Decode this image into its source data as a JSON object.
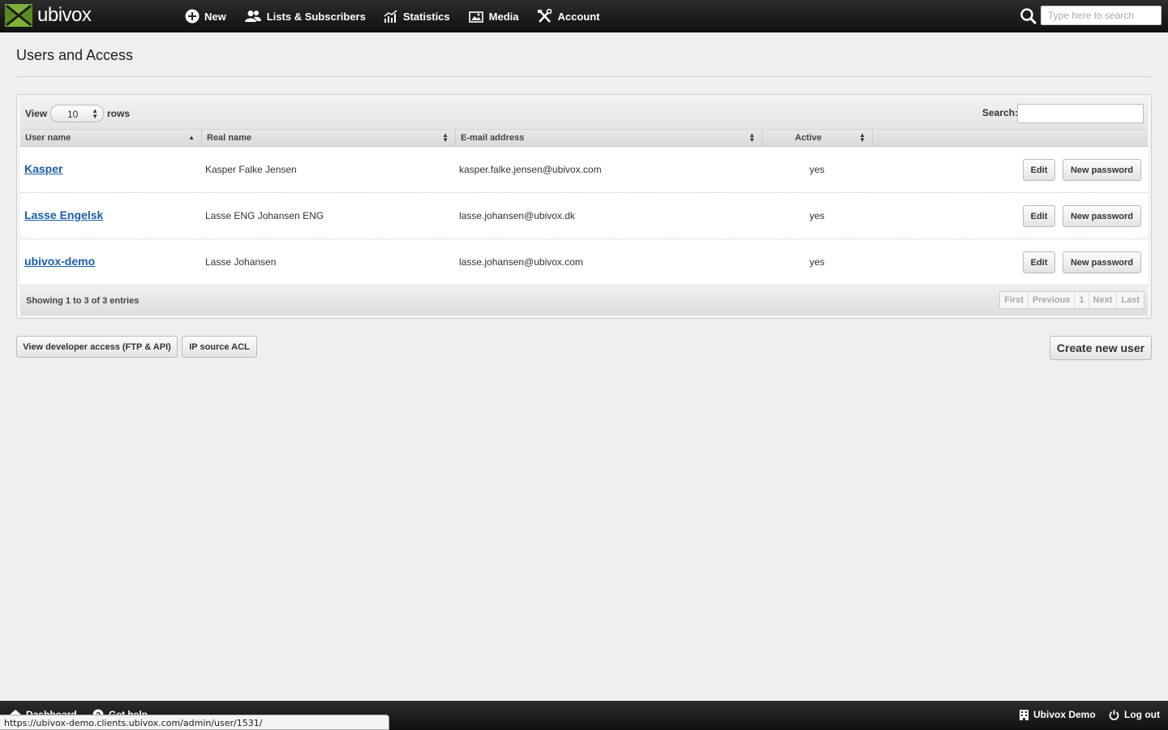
{
  "header": {
    "logo_text": "ubivox",
    "nav": [
      {
        "label": "New",
        "icon": "plus-circle-icon"
      },
      {
        "label": "Lists & Subscribers",
        "icon": "users-icon"
      },
      {
        "label": "Statistics",
        "icon": "bar-chart-icon"
      },
      {
        "label": "Media",
        "icon": "image-icon"
      },
      {
        "label": "Account",
        "icon": "tools-icon"
      }
    ],
    "search_placeholder": "Type here to search"
  },
  "page": {
    "title": "Users and Access"
  },
  "table": {
    "view_label": "View",
    "rows_value": "10",
    "rows_label": "rows",
    "search_label": "Search:",
    "columns": [
      "User name",
      "Real name",
      "E-mail address",
      "Active"
    ],
    "rows": [
      {
        "username": "Kasper",
        "realname": "Kasper Falke Jensen",
        "email": "kasper.falke.jensen@ubivox.com",
        "active": "yes"
      },
      {
        "username": "Lasse Engelsk",
        "realname": "Lasse ENG Johansen ENG",
        "email": "lasse.johansen@ubivox.dk",
        "active": "yes"
      },
      {
        "username": "ubivox-demo",
        "realname": "Lasse Johansen",
        "email": "lasse.johansen@ubivox.com",
        "active": "yes"
      }
    ],
    "edit_label": "Edit",
    "new_password_label": "New password",
    "showing": "Showing 1 to 3 of 3 entries",
    "pager": [
      "First",
      "Previous",
      "1",
      "Next",
      "Last"
    ]
  },
  "actions": {
    "developer_access": "View developer access (FTP & API)",
    "ip_acl": "IP source ACL",
    "create_user": "Create new user"
  },
  "footer": {
    "dashboard": "Dashboard",
    "help": "Get help",
    "account_name": "Ubivox Demo",
    "logout": "Log out"
  },
  "status_bar_url": "https://ubivox-demo.clients.ubivox.com/admin/user/1531/"
}
